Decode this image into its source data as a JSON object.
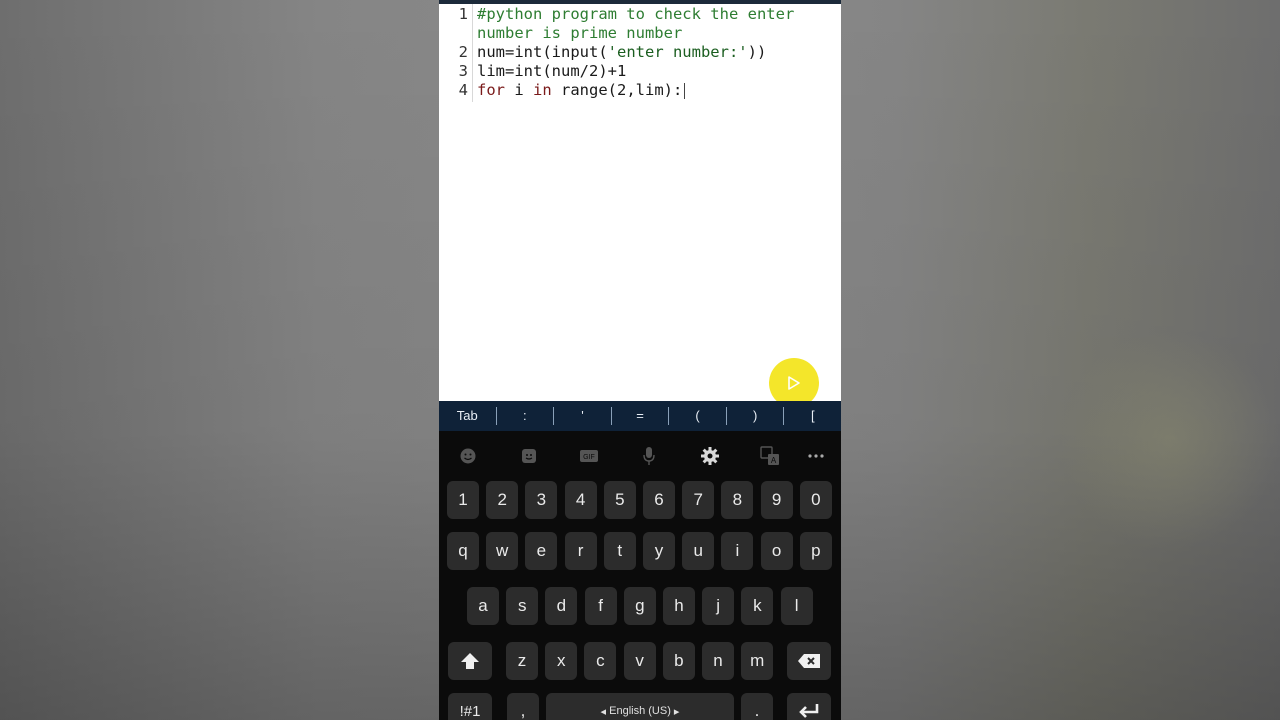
{
  "editor": {
    "lines": [
      {
        "num": "1",
        "parts": [
          {
            "t": "#python program to check the enter",
            "c": "comment"
          }
        ]
      },
      {
        "num": "",
        "parts": [
          {
            "t": "number is prime number",
            "c": "comment"
          }
        ]
      },
      {
        "num": "2",
        "parts": [
          {
            "t": "num=int(input(",
            "c": ""
          },
          {
            "t": "'enter number:'",
            "c": "str"
          },
          {
            "t": "))",
            "c": ""
          }
        ]
      },
      {
        "num": "3",
        "parts": [
          {
            "t": "lim=int(num/2)+1",
            "c": ""
          }
        ]
      },
      {
        "num": "4",
        "parts": [
          {
            "t": "for",
            "c": "kw"
          },
          {
            "t": " i ",
            "c": ""
          },
          {
            "t": "in",
            "c": "kw"
          },
          {
            "t": " range(2,lim):",
            "c": ""
          }
        ]
      }
    ]
  },
  "run_button": {
    "icon": "play-icon",
    "color": "#f4e62a"
  },
  "symbol_bar": [
    "Tab",
    ":",
    "'",
    "=",
    "(",
    ")",
    "["
  ],
  "keyboard": {
    "toolbar": [
      "emoji-icon",
      "sticker-icon",
      "gif-icon",
      "microphone-icon",
      "settings-icon",
      "translate-icon",
      "more-icon"
    ],
    "row_numbers": [
      "1",
      "2",
      "3",
      "4",
      "5",
      "6",
      "7",
      "8",
      "9",
      "0"
    ],
    "row_q": [
      "q",
      "w",
      "e",
      "r",
      "t",
      "y",
      "u",
      "i",
      "o",
      "p"
    ],
    "row_a": [
      "a",
      "s",
      "d",
      "f",
      "g",
      "h",
      "j",
      "k",
      "l"
    ],
    "row_z": [
      "z",
      "x",
      "c",
      "v",
      "b",
      "n",
      "m"
    ],
    "bottom": {
      "symbols": "!#1",
      "comma": ",",
      "space": "English (US)",
      "period": "."
    }
  },
  "colors": {
    "symbar_bg": "#0f2238",
    "keyboard_bg": "#0b0b0b",
    "key_bg": "#2c2c2c"
  }
}
